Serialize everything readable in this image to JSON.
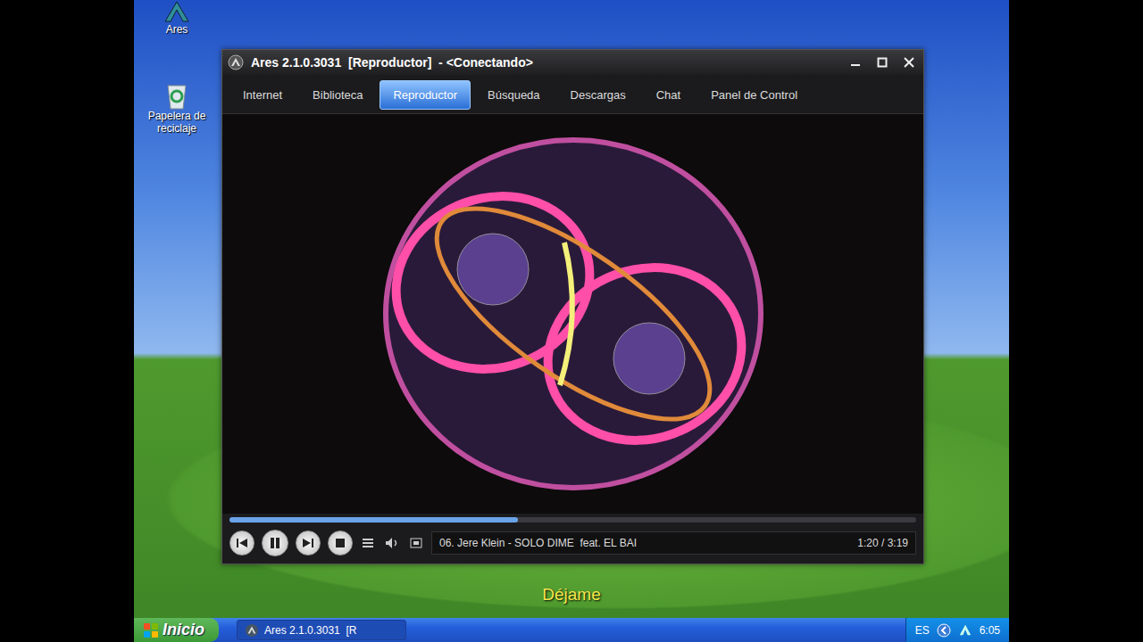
{
  "desktop_icons": [
    {
      "label": "Ares"
    },
    {
      "label": "Papelera de reciclaje"
    }
  ],
  "window": {
    "title": "Ares 2.1.0.3031  [Reproductor]  - <Conectando>"
  },
  "tabs": [
    {
      "label": "Internet",
      "selected": false
    },
    {
      "label": "Biblioteca",
      "selected": false
    },
    {
      "label": "Reproductor",
      "selected": true
    },
    {
      "label": "Búsqueda",
      "selected": false
    },
    {
      "label": "Descargas",
      "selected": false
    },
    {
      "label": "Chat",
      "selected": false
    },
    {
      "label": "Panel de Control",
      "selected": false
    }
  ],
  "player": {
    "playing": true,
    "track": "06. Jere Klein - SOLO DIME  feat. EL BAI",
    "time": "1:20 / 3:19",
    "level": 0.42
  },
  "caption": "Déjame",
  "taskbar": {
    "start": "Inicio",
    "tasks": [
      {
        "label": "Ares 2.1.0.3031  [R",
        "selected": true
      }
    ],
    "language": "ES",
    "clock": "6:05"
  }
}
